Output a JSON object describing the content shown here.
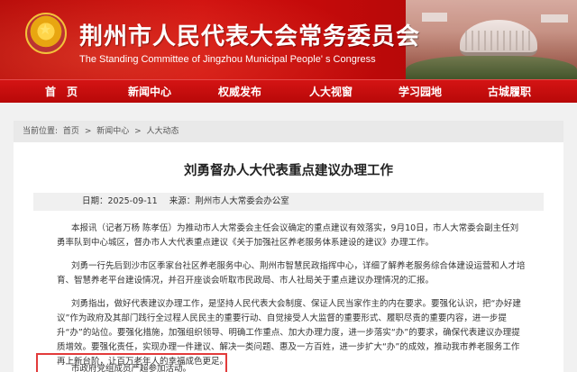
{
  "header": {
    "title_cn": "荆州市人民代表大会常务委员会",
    "title_en": "The Standing Committee of Jingzhou Municipal People' s Congress"
  },
  "nav": {
    "items": [
      {
        "label": "首　页"
      },
      {
        "label": "新闻中心"
      },
      {
        "label": "权威发布"
      },
      {
        "label": "人大视窗"
      },
      {
        "label": "学习园地"
      },
      {
        "label": "古城履职"
      }
    ]
  },
  "breadcrumb": {
    "prefix": "当前位置:",
    "items": [
      "首页",
      "新闻中心",
      "人大动态"
    ],
    "separator": ">"
  },
  "article": {
    "title": "刘勇督办人大代表重点建议办理工作",
    "date_label": "日期：2025-09-11",
    "source_label": "来源：荆州市人大常委会办公室",
    "paragraphs": [
      "本报讯（记者万杨 陈孝伍）为推动市人大常委会主任会议确定的重点建议有效落实，9月10日，市人大常委会副主任刘勇率队到中心城区，督办市人大代表重点建议《关于加强社区养老服务体系建设的建议》办理工作。",
      "刘勇一行先后到沙市区季家台社区养老服务中心、荆州市智慧民政指挥中心，详细了解养老服务综合体建设运营和人才培育、智慧养老平台建设情况，并召开座谈会听取市民政局、市人社局关于重点建议办理情况的汇报。",
      "刘勇指出，做好代表建议办理工作，是坚持人民代表大会制度、保证人民当家作主的内在要求。要强化认识，把“办好建议”作为政府及其部门践行全过程人民民主的重要行动、自觉接受人大监督的重要形式、履职尽责的重要内容，进一步提升“办”的站位。要强化措施，加强组织领导、明确工作重点、加大办理力度，进一步落实“办”的要求，确保代表建议办理提质增效。要强化责任，实现办理一件建议、解决一类问题、惠及一方百姓，进一步扩大“办”的成效，推动我市养老服务工作再上新台阶，让百万老年人的幸福成色更足。",
      "市政府党组成员严超参加活动。"
    ]
  }
}
